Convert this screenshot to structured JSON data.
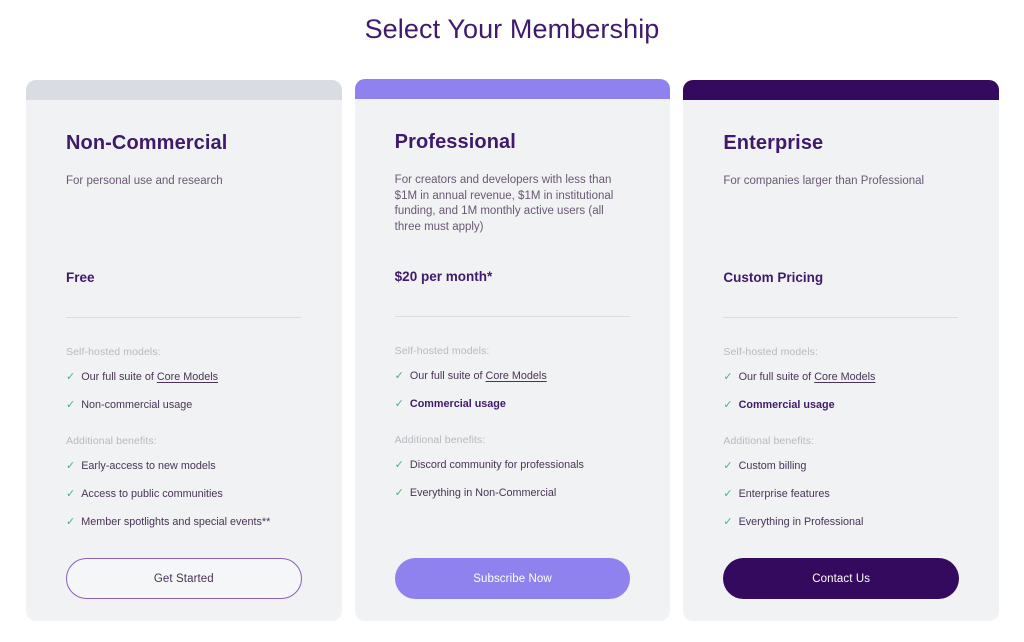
{
  "page": {
    "title": "Select Your Membership"
  },
  "colors": {
    "title_purple": "#3f1a6b",
    "bar_noncommercial": "#dadce4",
    "bar_professional": "#8f82ef",
    "bar_enterprise": "#340a5e",
    "check_green": "#47b37f",
    "card_background": "#f1f2f4",
    "cta_outline_border": "#8b5fbf",
    "cta_professional_fill": "#8f82ef",
    "cta_enterprise_fill": "#340a5e"
  },
  "plans": [
    {
      "id": "non-commercial",
      "name": "Non-Commercial",
      "description": "For personal use and research",
      "price": "Free",
      "bar_color": "#dadce4",
      "cta_label": "Get Started",
      "groups": [
        {
          "label": "Self-hosted models:",
          "items": [
            {
              "check": "✓",
              "text_before": "Our full suite of ",
              "link": "Core Models",
              "text_after": "",
              "bold": false
            },
            {
              "check": "✓",
              "text_before": "Non-commercial usage",
              "link": "",
              "text_after": "",
              "bold": false
            }
          ]
        },
        {
          "label": "Additional benefits:",
          "items": [
            {
              "check": "✓",
              "text_before": "Early-access to new models",
              "link": "",
              "text_after": "",
              "bold": false
            },
            {
              "check": "✓",
              "text_before": "Access to public communities",
              "link": "",
              "text_after": "",
              "bold": false
            },
            {
              "check": "✓",
              "text_before": "Member spotlights and special events**",
              "link": "",
              "text_after": "",
              "bold": false
            }
          ]
        }
      ]
    },
    {
      "id": "professional",
      "name": "Professional",
      "description": "For creators and developers with less than $1M in annual revenue, $1M in institutional funding, and 1M monthly active users (all three must apply)",
      "price": "$20 per month*",
      "bar_color": "#8f82ef",
      "cta_label": "Subscribe Now",
      "groups": [
        {
          "label": "Self-hosted models:",
          "items": [
            {
              "check": "✓",
              "text_before": "Our full suite of ",
              "link": "Core Models",
              "text_after": "",
              "bold": false
            },
            {
              "check": "✓",
              "text_before": "Commercial usage",
              "link": "",
              "text_after": "",
              "bold": true
            }
          ]
        },
        {
          "label": "Additional benefits:",
          "items": [
            {
              "check": "✓",
              "text_before": "Discord community for professionals",
              "link": "",
              "text_after": "",
              "bold": false
            },
            {
              "check": "✓",
              "text_before": "Everything in Non-Commercial",
              "link": "",
              "text_after": "",
              "bold": false
            }
          ]
        }
      ]
    },
    {
      "id": "enterprise",
      "name": "Enterprise",
      "description": "For companies larger than Professional",
      "price": "Custom Pricing",
      "bar_color": "#340a5e",
      "cta_label": "Contact Us",
      "groups": [
        {
          "label": "Self-hosted models:",
          "items": [
            {
              "check": "✓",
              "text_before": "Our full suite of ",
              "link": "Core Models",
              "text_after": "",
              "bold": false
            },
            {
              "check": "✓",
              "text_before": "Commercial usage",
              "link": "",
              "text_after": "",
              "bold": true
            }
          ]
        },
        {
          "label": "Additional benefits:",
          "items": [
            {
              "check": "✓",
              "text_before": "Custom billing",
              "link": "",
              "text_after": "",
              "bold": false
            },
            {
              "check": "✓",
              "text_before": "Enterprise features",
              "link": "",
              "text_after": "",
              "bold": false
            },
            {
              "check": "✓",
              "text_before": "Everything in Professional",
              "link": "",
              "text_after": "",
              "bold": false
            }
          ]
        }
      ]
    }
  ]
}
